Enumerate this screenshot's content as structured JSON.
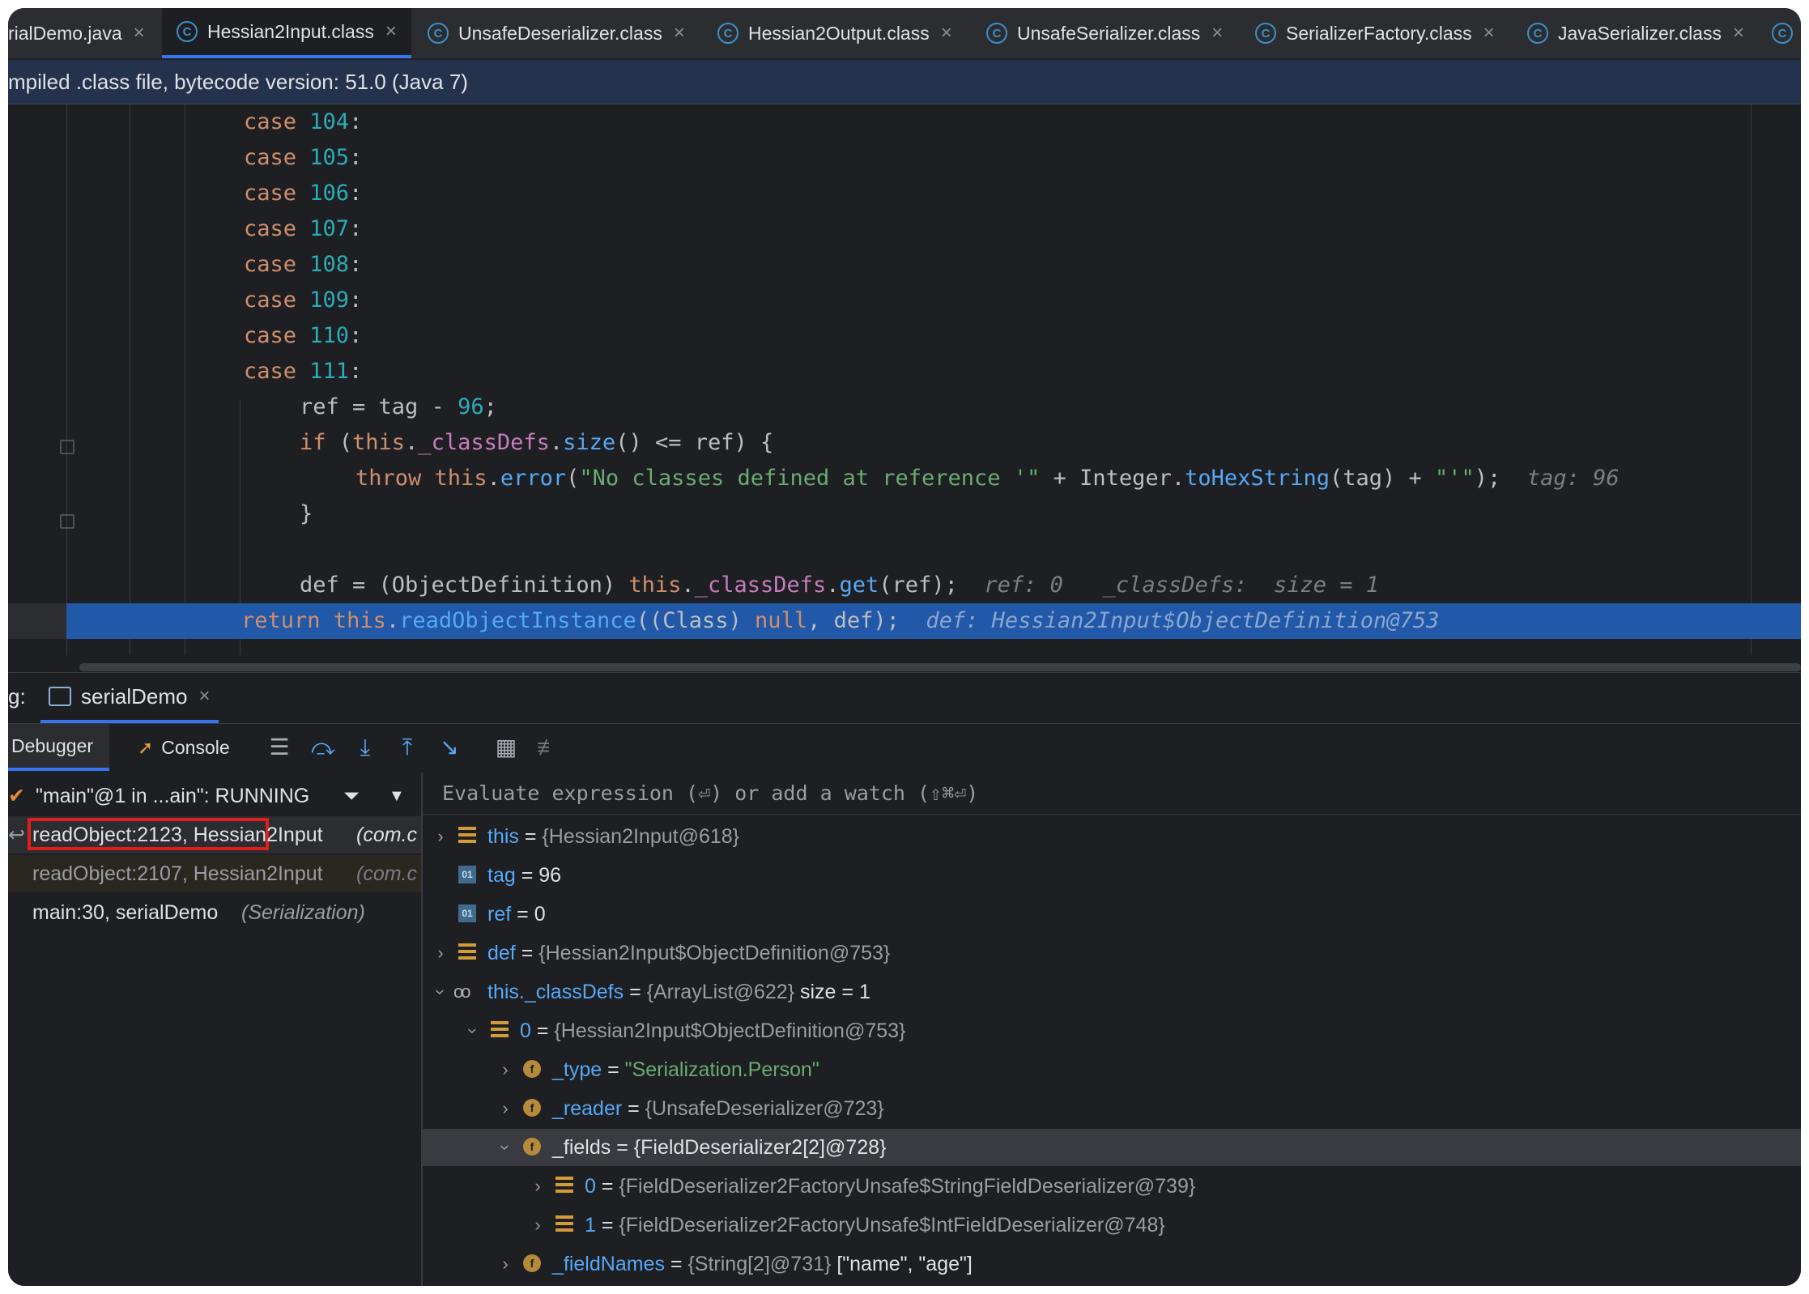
{
  "tabs": [
    {
      "label": "rialDemo.java",
      "icon": "java-file-icon",
      "active": false
    },
    {
      "label": "Hessian2Input.class",
      "icon": "class-file-icon",
      "active": true
    },
    {
      "label": "UnsafeDeserializer.class",
      "icon": "class-file-icon",
      "active": false
    },
    {
      "label": "Hessian2Output.class",
      "icon": "class-file-icon",
      "active": false
    },
    {
      "label": "UnsafeSerializer.class",
      "icon": "class-file-icon",
      "active": false
    },
    {
      "label": "SerializerFactory.class",
      "icon": "class-file-icon",
      "active": false
    },
    {
      "label": "JavaSerializer.class",
      "icon": "class-file-icon",
      "active": false
    }
  ],
  "banner": "mpiled .class file, bytecode version: 51.0 (Java 7)",
  "code": {
    "cases": [
      "104",
      "105",
      "106",
      "107",
      "108",
      "109",
      "110",
      "111"
    ],
    "case_kw": "case",
    "hint_tag": "tag: 96",
    "hint_ref": "ref: 0",
    "hint_classdefs": "_classDefs:  size = 1",
    "hint_def": "def: Hessian2Input$ObjectDefinition@753"
  },
  "run": {
    "prefix": "g:",
    "tab_label": "serialDemo"
  },
  "toolbar": {
    "debugger_label": "Debugger",
    "console_label": "Console"
  },
  "thread": {
    "label": "\"main\"@1 in ...ain\": RUNNING"
  },
  "frames": [
    {
      "method": "readObject:2123, Hessian2Input",
      "pkg": "(com.c",
      "selected": true
    },
    {
      "method": "readObject:2107, Hessian2Input",
      "pkg": "(com.c",
      "selected": false
    },
    {
      "method": "main:30, serialDemo",
      "pkg": "(Serialization)",
      "selected": false
    }
  ],
  "eval_placeholder": "Evaluate expression (⏎) or add a watch (⇧⌘⏎)",
  "variables": [
    {
      "name": "this",
      "value": "{Hessian2Input@618}",
      "extra": ""
    },
    {
      "name": "tag",
      "value": "96",
      "extra": ""
    },
    {
      "name": "ref",
      "value": "0",
      "extra": ""
    },
    {
      "name": "def",
      "value": "{Hessian2Input$ObjectDefinition@753}",
      "extra": ""
    },
    {
      "name": "this._classDefs",
      "value": "{ArrayList@622}",
      "extra": "size = 1"
    },
    {
      "name": "0",
      "value": "{Hessian2Input$ObjectDefinition@753}",
      "extra": ""
    },
    {
      "name": "_type",
      "value": "\"Serialization.Person\"",
      "extra": ""
    },
    {
      "name": "_reader",
      "value": "{UnsafeDeserializer@723}",
      "extra": ""
    },
    {
      "name": "_fields",
      "value": "{FieldDeserializer2[2]@728}",
      "extra": ""
    },
    {
      "name": "0",
      "value": "{FieldDeserializer2FactoryUnsafe$StringFieldDeserializer@739}",
      "extra": ""
    },
    {
      "name": "1",
      "value": "{FieldDeserializer2FactoryUnsafe$IntFieldDeserializer@748}",
      "extra": ""
    },
    {
      "name": "_fieldNames",
      "value": "{String[2]@731}",
      "extra": "[\"name\", \"age\"]"
    }
  ],
  "colors": {
    "accent": "#3574f0",
    "selection_highlight": "#2158a8",
    "frame_marker": "#e11d1d"
  }
}
